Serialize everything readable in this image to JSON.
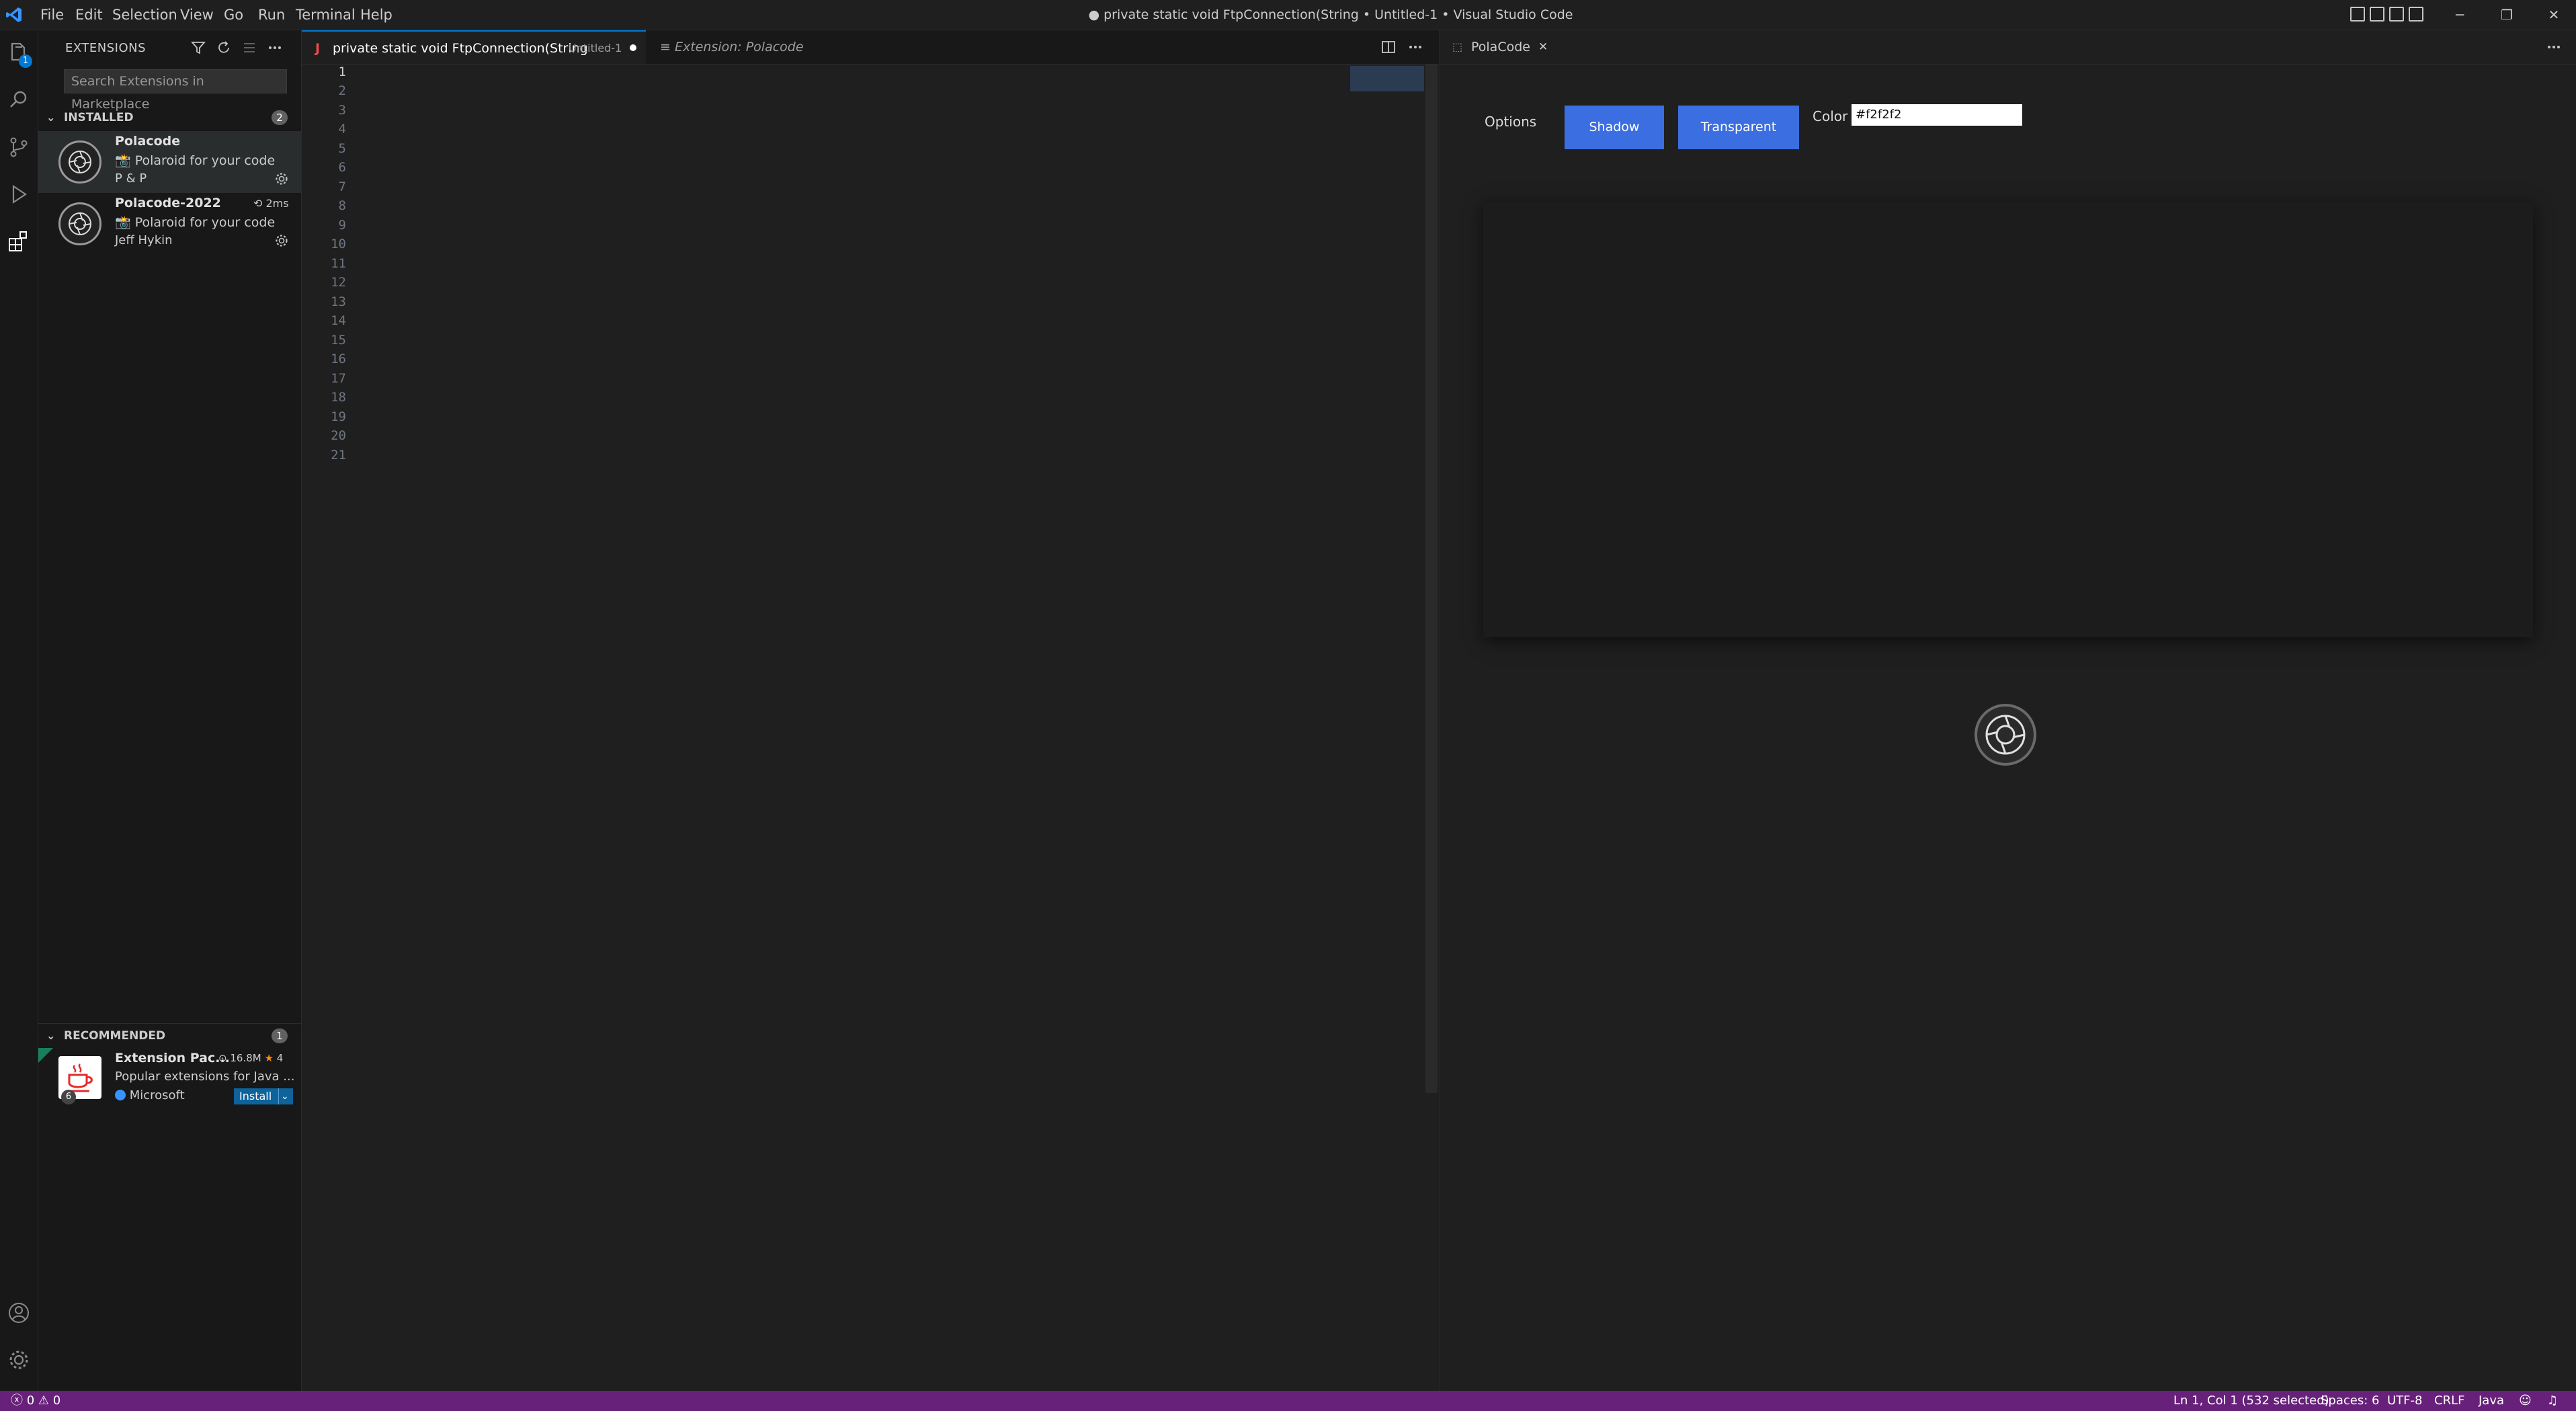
{
  "window": {
    "title": "● private static void FtpConnection(String • Untitled-1 • Visual Studio Code",
    "menu": [
      "File",
      "Edit",
      "Selection",
      "View",
      "Go",
      "Run",
      "Terminal",
      "Help"
    ],
    "controls": {
      "minimize": "─",
      "restore": "❐",
      "close": "✕"
    }
  },
  "activity_bar": {
    "icons": [
      "explorer-icon",
      "search-icon",
      "source-control-icon",
      "run-debug-icon",
      "extensions-icon",
      "accounts-icon",
      "manage-gear-icon"
    ],
    "explorer_badge": "1"
  },
  "sidebar": {
    "title": "EXTENSIONS",
    "search_placeholder": "Search Extensions in Marketplace",
    "installed": {
      "label": "INSTALLED",
      "count": "2",
      "items": [
        {
          "name": "Polacode",
          "description": "📸 Polaroid for your code",
          "publisher": "P & P"
        },
        {
          "name": "Polacode-2022",
          "time": "2ms",
          "description": "📸 Polaroid for your code",
          "publisher": "Jeff Hykin"
        }
      ]
    },
    "recommended": {
      "label": "RECOMMENDED",
      "count": "1",
      "items": [
        {
          "name": "Extension Pac...",
          "downloads": "16.8M",
          "rating": "4",
          "description": "Popular extensions for Java ...",
          "publisher": "Microsoft",
          "install_label": "Install",
          "icon_count": "6"
        }
      ]
    }
  },
  "editor": {
    "tabs": [
      {
        "label": "private static void FtpConnection(String",
        "detail": "Untitled-1",
        "lang_icon": "J"
      },
      {
        "label": "Extension: Polacode"
      }
    ],
    "line_numbers": [
      "1",
      "2",
      "3",
      "4",
      "5",
      "6",
      "7",
      "8",
      "9",
      "10",
      "11",
      "12",
      "13",
      "14",
      "15",
      "16",
      "17",
      "18",
      "19",
      "20",
      "21"
    ]
  },
  "polacode": {
    "tab_label": "PolaCode",
    "options_label": "Options",
    "shadow_label": "Shadow",
    "transparent_label": "Transparent",
    "color_label": "Color",
    "color_value": "#f2f2f2"
  },
  "status_bar": {
    "problems": "ⓧ 0 ⚠ 0",
    "position": "Ln 1, Col 1 (532 selected)",
    "spaces": "Spaces: 6",
    "encoding": "UTF-8",
    "eol": "CRLF",
    "language": "Java"
  },
  "colors": {
    "accent_button": "#3b6ee0",
    "status_bar": "#68217a",
    "selection": "#264f78"
  }
}
